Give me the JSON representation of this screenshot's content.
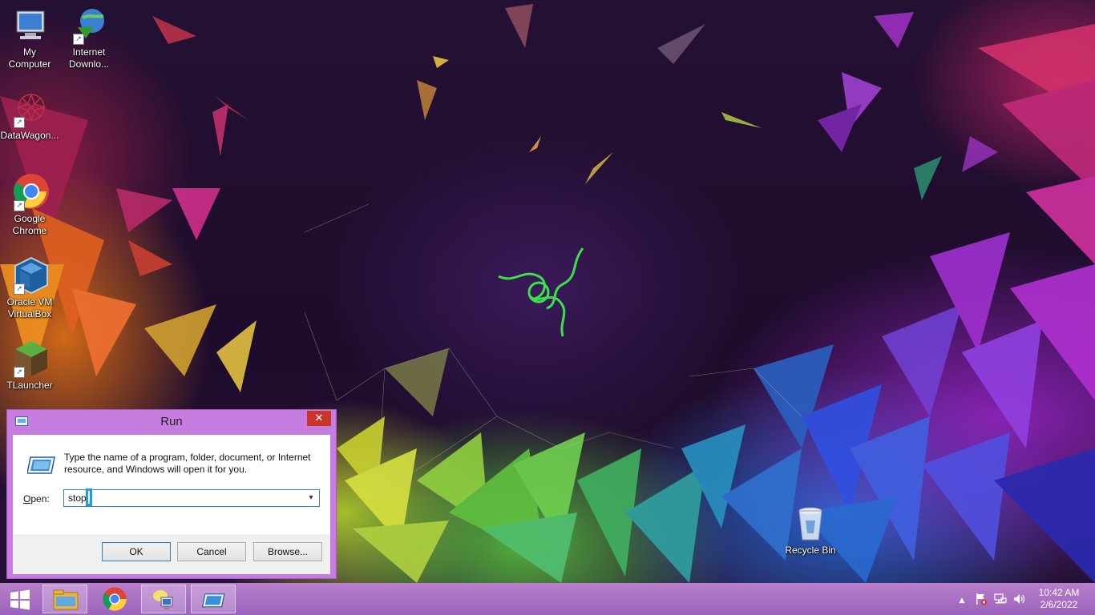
{
  "desktop": {
    "icons": [
      {
        "label_line1": "My",
        "label_line2": "Computer",
        "icon": "computer-icon"
      },
      {
        "label_line1": "Internet",
        "label_line2": "Downlo...",
        "icon": "internet-download-manager-icon"
      },
      {
        "label_line1": "DataWagon...",
        "label_line2": "",
        "icon": "datawagon-icon"
      },
      {
        "label_line1": "Google",
        "label_line2": "Chrome",
        "icon": "chrome-icon"
      },
      {
        "label_line1": "Oracle VM",
        "label_line2": "VirtualBox",
        "icon": "virtualbox-icon"
      },
      {
        "label_line1": "TLauncher",
        "label_line2": "",
        "icon": "tlauncher-icon"
      },
      {
        "label_line1": "Recycle Bin",
        "label_line2": "",
        "icon": "recycle-bin-icon"
      }
    ],
    "shortcut_arrow": "↗"
  },
  "run_dialog": {
    "title": "Run",
    "close_glyph": "✕",
    "description": "Type the name of a program, folder, document, or Internet resource, and Windows will open it for you.",
    "open_label_accel": "O",
    "open_label_rest": "pen:",
    "open_value": "stop",
    "dropdown_glyph": "▾",
    "ok_label": "OK",
    "cancel_label": "Cancel",
    "browse_label": "Browse...",
    "accent_color": "#c77ce0"
  },
  "taskbar": {
    "apps": [
      {
        "name": "file-explorer",
        "icon": "folder-icon"
      },
      {
        "name": "google-chrome",
        "icon": "chrome-icon"
      },
      {
        "name": "network-app",
        "icon": "network-app-icon"
      },
      {
        "name": "run",
        "icon": "run-icon",
        "active": true
      }
    ],
    "tray": {
      "show_hidden_glyph": "▲",
      "time": "10:42 AM",
      "date": "2/6/2022"
    }
  }
}
